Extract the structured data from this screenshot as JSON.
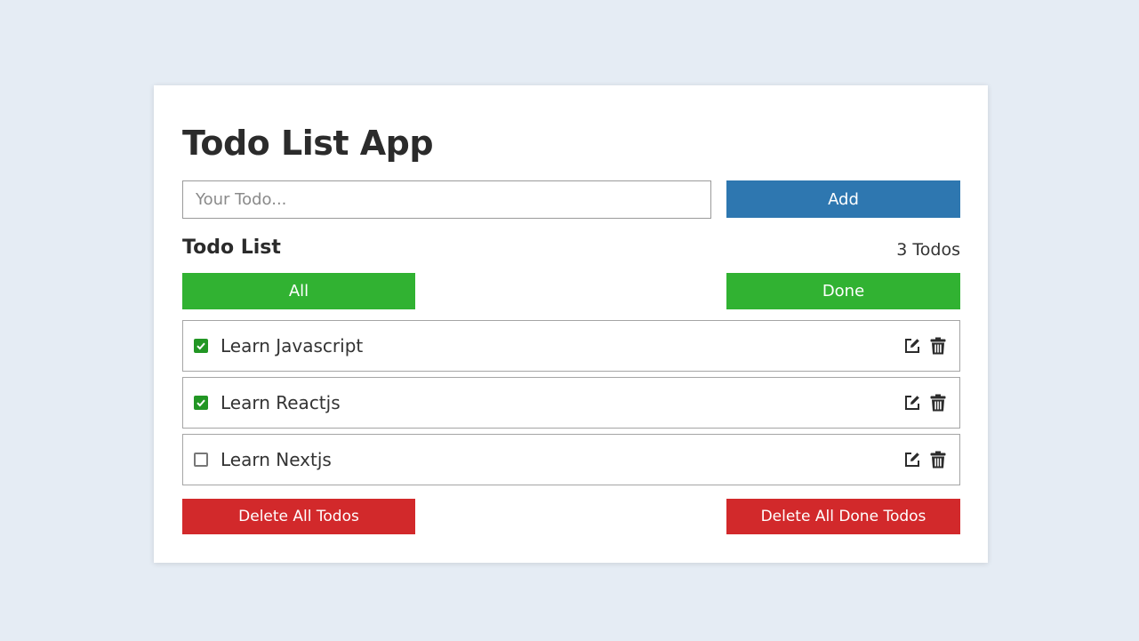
{
  "app": {
    "title": "Todo List App"
  },
  "form": {
    "input_placeholder": "Your Todo...",
    "input_value": "",
    "add_label": "Add"
  },
  "list": {
    "heading": "Todo List",
    "count_label": "3 Todos",
    "filter_all_label": "All",
    "filter_done_label": "Done",
    "items": [
      {
        "text": "Learn Javascript",
        "done": true,
        "icons": [
          "checkbox-checked-icon",
          "edit-icon",
          "trash-icon"
        ]
      },
      {
        "text": "Learn Reactjs",
        "done": true,
        "icons": [
          "checkbox-checked-icon",
          "edit-icon",
          "trash-icon"
        ]
      },
      {
        "text": "Learn Nextjs",
        "done": false,
        "icons": [
          "checkbox-unchecked-icon",
          "edit-icon",
          "trash-icon"
        ]
      }
    ]
  },
  "footer": {
    "delete_all_label": "Delete All Todos",
    "delete_done_label": "Delete All Done Todos"
  },
  "colors": {
    "background": "#e5ecf4",
    "add_button": "#2e77b0",
    "filter_button": "#31b232",
    "delete_button": "#d2292b",
    "checkbox_checked": "#229624"
  }
}
